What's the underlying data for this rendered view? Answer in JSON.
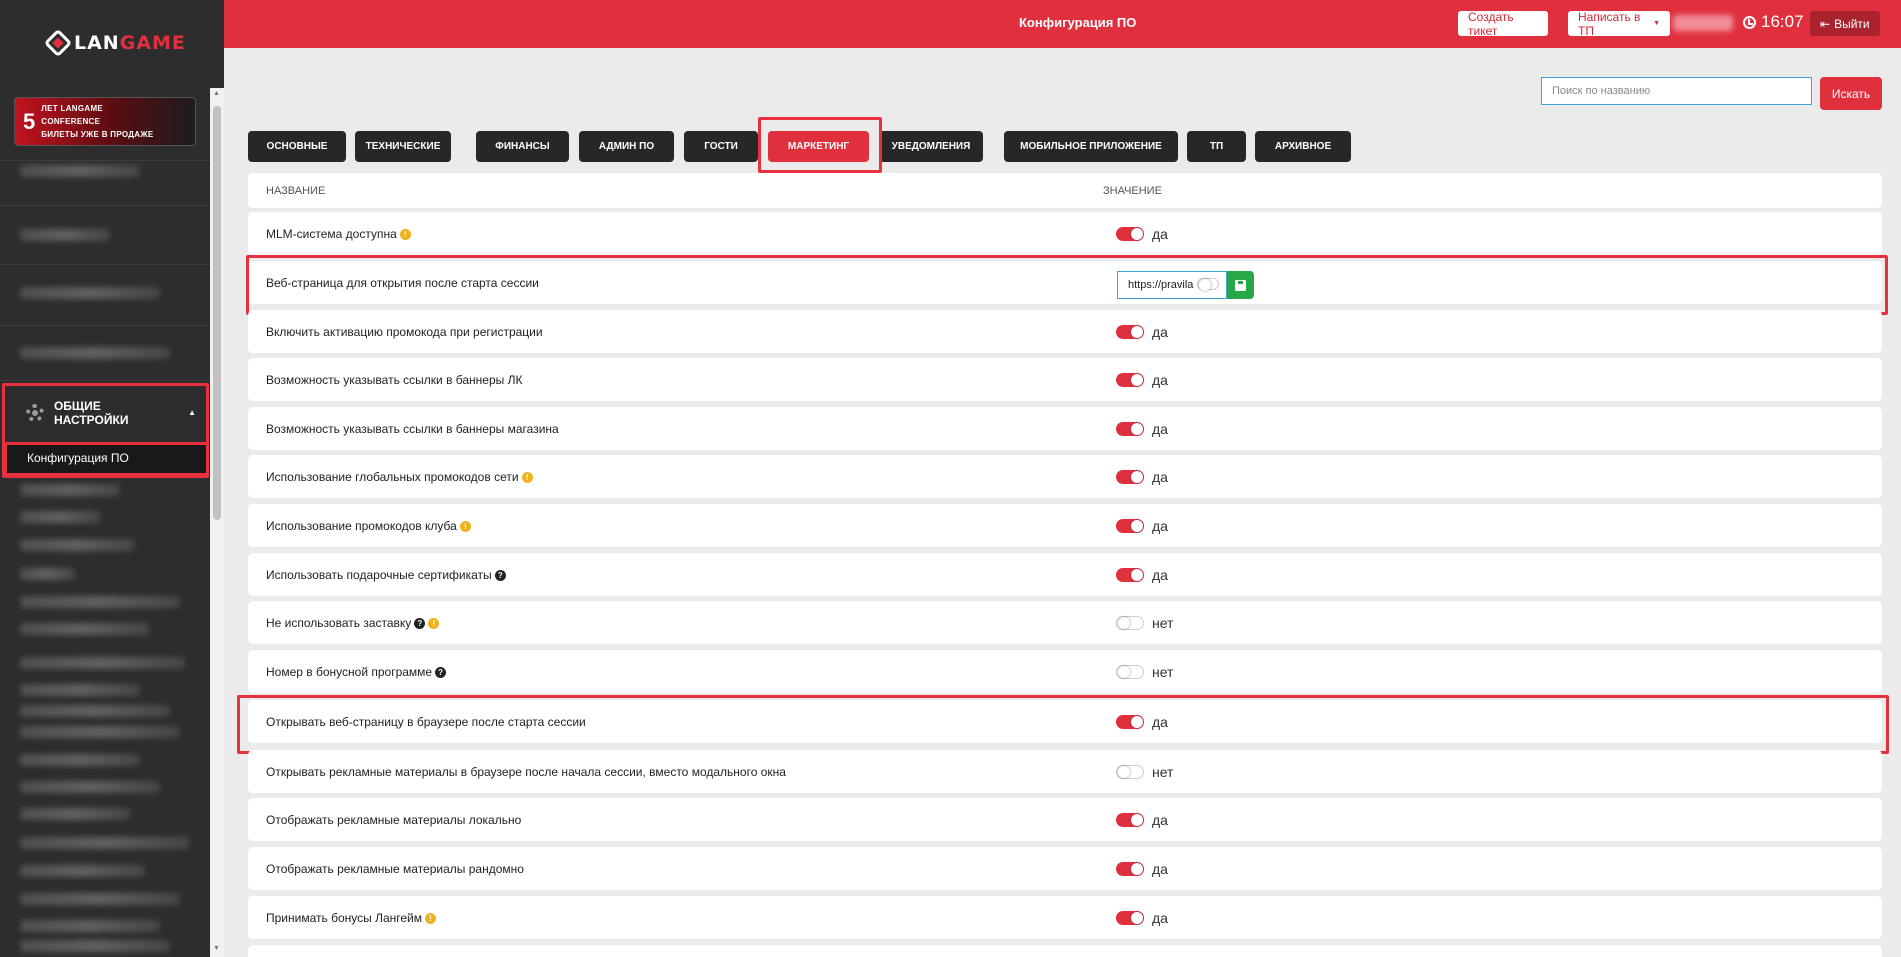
{
  "app": {
    "logo_prefix": "LAN",
    "logo_suffix": "GAME",
    "page_title": "Конфигурация ПО"
  },
  "promo": {
    "number": "5",
    "line1": "ЛЕТ LANGAME",
    "line2": "CONFERENCE",
    "line3": "БИЛЕТЫ УЖЕ В ПРОДАЖЕ"
  },
  "sidebar": {
    "group_label": "ОБЩИЕ НАСТРОЙКИ",
    "group_icon": "gear-icon",
    "active_item": "Конфигурация ПО"
  },
  "header": {
    "create_ticket": "Создать тикет",
    "write_support": "Написать в ТП",
    "time": "16:07",
    "logout": "Выйти"
  },
  "search": {
    "placeholder": "Поиск по названию",
    "button": "Искать"
  },
  "tabs": [
    {
      "label": "ОСНОВНЫЕ"
    },
    {
      "label": "ТЕХНИЧЕСКИЕ"
    },
    {
      "label": "ФИНАНСЫ"
    },
    {
      "label": "АДМИН ПО"
    },
    {
      "label": "ГОСТИ"
    },
    {
      "label": "МАРКЕТИНГ",
      "active": true
    },
    {
      "label": "УВЕДОМЛЕНИЯ"
    },
    {
      "label": "МОБИЛЬНОЕ ПРИЛОЖЕНИЕ"
    },
    {
      "label": "ТП"
    },
    {
      "label": "АРХИВНОЕ"
    }
  ],
  "table": {
    "col_name": "НАЗВАНИЕ",
    "col_value": "ЗНАЧЕНИЕ",
    "rows": [
      {
        "name": "MLM-система доступна",
        "value": "да",
        "on": true
      },
      {
        "name": "Веб-страница для открытия после старта сессии",
        "value": "https://pravila"
      },
      {
        "name": "Включить активацию промокода при регистрации",
        "value": "да",
        "on": true
      },
      {
        "name": "Возможность указывать ссылки в баннеры ЛК",
        "value": "да",
        "on": true
      },
      {
        "name": "Возможность указывать ссылки в баннеры магазина",
        "value": "да",
        "on": true
      },
      {
        "name": "Использование глобальных промокодов сети",
        "value": "да",
        "on": true
      },
      {
        "name": "Использование промокодов клуба",
        "value": "да",
        "on": true
      },
      {
        "name": "Использовать подарочные сертификаты",
        "value": "да",
        "on": true
      },
      {
        "name": "Не использовать заставку",
        "value": "нет",
        "on": false
      },
      {
        "name": "Номер в бонусной программе",
        "value": "нет",
        "on": false
      },
      {
        "name": "Открывать веб-страницу в браузере после старта сессии",
        "value": "да",
        "on": true
      },
      {
        "name": "Открывать рекламные материалы в браузере после начала сессии, вместо модального окна",
        "value": "нет",
        "on": false
      },
      {
        "name": "Отображать рекламные материалы локально",
        "value": "да",
        "on": true
      },
      {
        "name": "Отображать рекламные материалы рандомно",
        "value": "да",
        "on": true
      },
      {
        "name": "Принимать бонусы Лангейм",
        "value": "да",
        "on": true
      }
    ]
  },
  "colors": {
    "accent": "#e0303e",
    "sidebar_bg": "#2d2d2d",
    "tab_bg": "#272727",
    "save_green": "#28a745",
    "info_yellow": "#f0b21c"
  }
}
